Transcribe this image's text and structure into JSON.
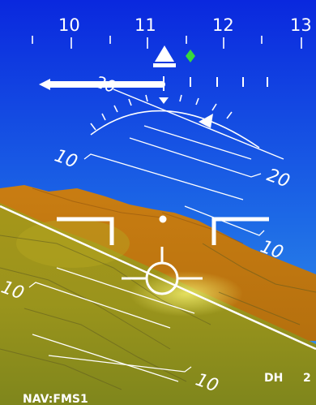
{
  "heading_tape": {
    "labels": [
      "10",
      "11",
      "12",
      "13"
    ]
  },
  "pitch_ladder": {
    "labels": [
      "20",
      "10",
      "20",
      "10",
      "10",
      "10"
    ]
  },
  "footer": {
    "nav_source": "NAV:FMS1",
    "dh_label": "DH",
    "dh_value": "2"
  },
  "colors": {
    "sky_top": "#0a2ae0",
    "sky_bottom": "#2d8ce8",
    "terrain_brown": "#c9780f",
    "terrain_yellow": "#a89c1a",
    "terrain_olive": "#8c8e1c",
    "hud": "#ffffff",
    "bug_green": "#37d93a"
  },
  "icons": [
    "heading-pointer-icon",
    "track-diamond-icon",
    "flight-path-vector-icon",
    "aircraft-reference-icon"
  ]
}
